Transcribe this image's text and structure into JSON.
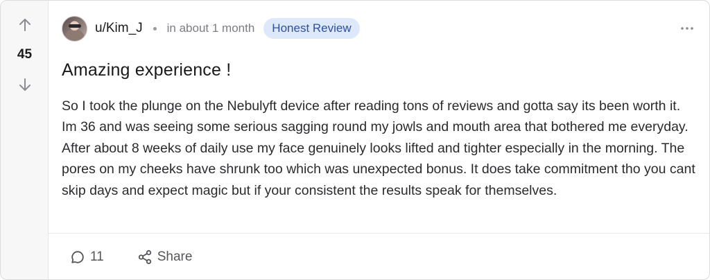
{
  "post": {
    "votes": "45",
    "author": "u/Kim_J",
    "time": "in about 1 month",
    "flair": "Honest Review",
    "title": "Amazing experience !",
    "body": "So I took the plunge on the Nebulyft device after reading tons of reviews and gotta say its been worth it. Im 36 and was seeing some serious sagging round my jowls and mouth area that bothered me everyday. After about 8 weeks of daily use my face genuinely looks lifted and tighter especially in the morning. The pores on my cheeks have shrunk too which was unexpected bonus. It does take commitment tho you cant skip days and expect magic but if your consistent the results speak for themselves."
  },
  "actions": {
    "comments_count": "11",
    "share_label": "Share"
  },
  "icons": {
    "upvote": "arrow-up-icon",
    "downvote": "arrow-down-icon",
    "more": "more-horizontal-icon",
    "comment": "comment-bubble-icon",
    "share": "share-icon"
  },
  "colors": {
    "flair_bg": "#dde9fb",
    "flair_text": "#2d4f9e",
    "vote_column_bg": "#f7f7f8"
  }
}
